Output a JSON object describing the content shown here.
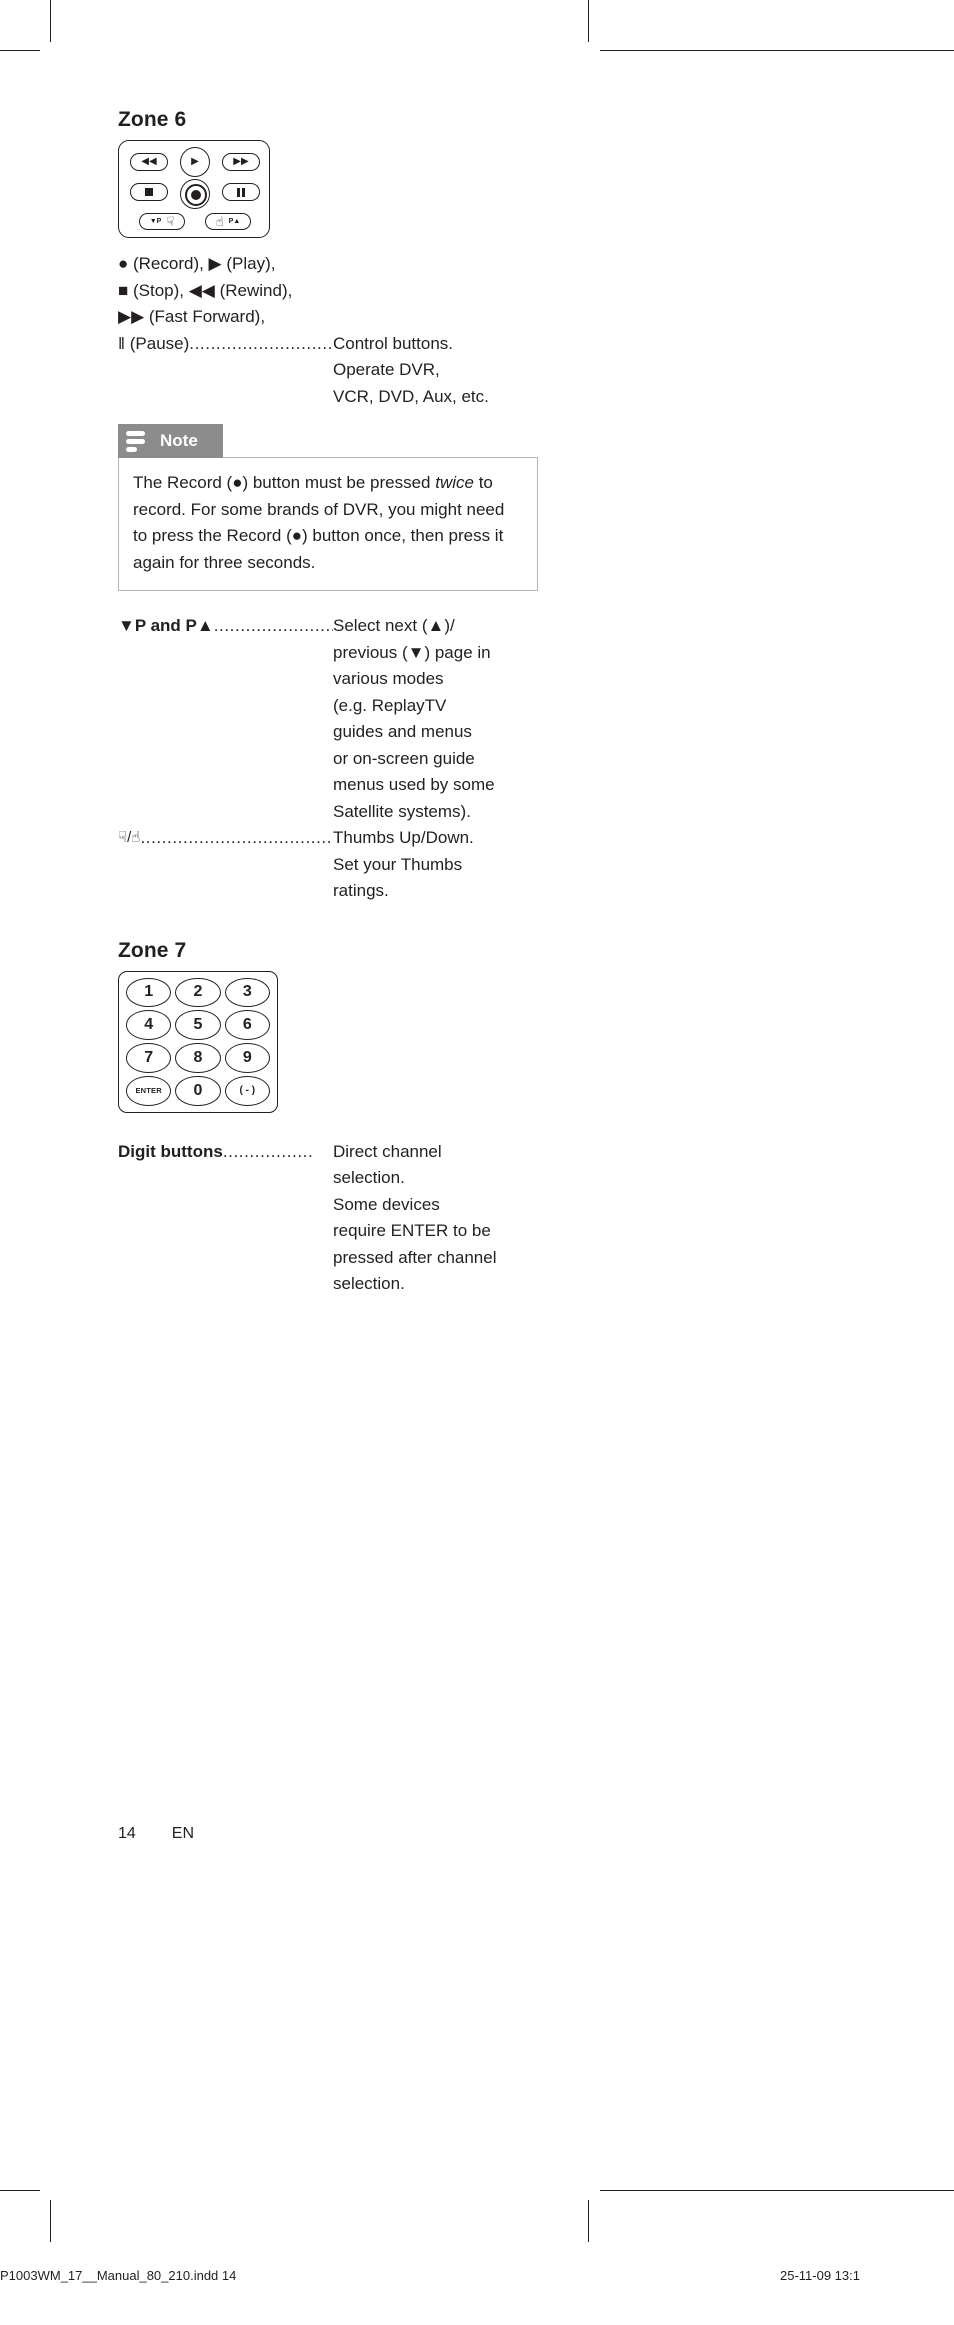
{
  "page": {
    "number": "14",
    "lang": "EN"
  },
  "print_footer": {
    "left": "P1003WM_17__Manual_80_210.indd   14",
    "right": "25-11-09   13:1"
  },
  "zone6": {
    "title": "Zone 6",
    "keys": {
      "rewind": "◀◀",
      "play": "▶",
      "forward": "▶▶",
      "stop": "■",
      "record": "●",
      "pause": "‖",
      "page_down": "▼P",
      "thumbs_down": "☟",
      "thumbs_up": "☝",
      "page_up": "P▲"
    },
    "legend_lines": [
      "●  (Record), ▶  (Play),",
      "■  (Stop), ◀◀ (Rewind),",
      "▶▶  (Fast Forward),"
    ],
    "pause_term": "‖ (Pause)",
    "pause_leader": "............................",
    "pause_desc": [
      "Control buttons.",
      "Operate DVR,",
      "VCR, DVD, Aux, etc."
    ]
  },
  "note": {
    "label": "Note",
    "text_part1": "The Record (●) button must be pressed ",
    "text_italic": "twice",
    "text_part2": " to record. For some brands of DVR, you might need to press the Record (●) button once, then press it again for three seconds."
  },
  "page_keys": {
    "term": "▼P  and P▲",
    "leader": ".......................",
    "desc": [
      "Select next (▲)/",
      "previous (▼) page in",
      "various modes",
      "(e.g. ReplayTV",
      "guides and menus",
      "or on-screen guide",
      "menus used by some",
      "Satellite systems)."
    ]
  },
  "thumbs": {
    "term": "☟/☝ ",
    "leader": "....................................",
    "desc": [
      "Thumbs Up/Down.",
      "Set your Thumbs",
      "ratings."
    ]
  },
  "zone7": {
    "title": "Zone 7",
    "keys": [
      "1",
      "2",
      "3",
      "4",
      "5",
      "6",
      "7",
      "8",
      "9",
      "ENTER",
      "0",
      "( - )"
    ]
  },
  "digit": {
    "term": "Digit buttons",
    "leader": " .................",
    "desc": [
      "Direct channel",
      "selection.",
      "Some devices",
      "require ENTER to be",
      "pressed after channel",
      "selection."
    ]
  },
  "colors": {
    "ink": "#231f20",
    "note_tab": "#8c8c8c",
    "note_border": "#b6b6b6"
  }
}
